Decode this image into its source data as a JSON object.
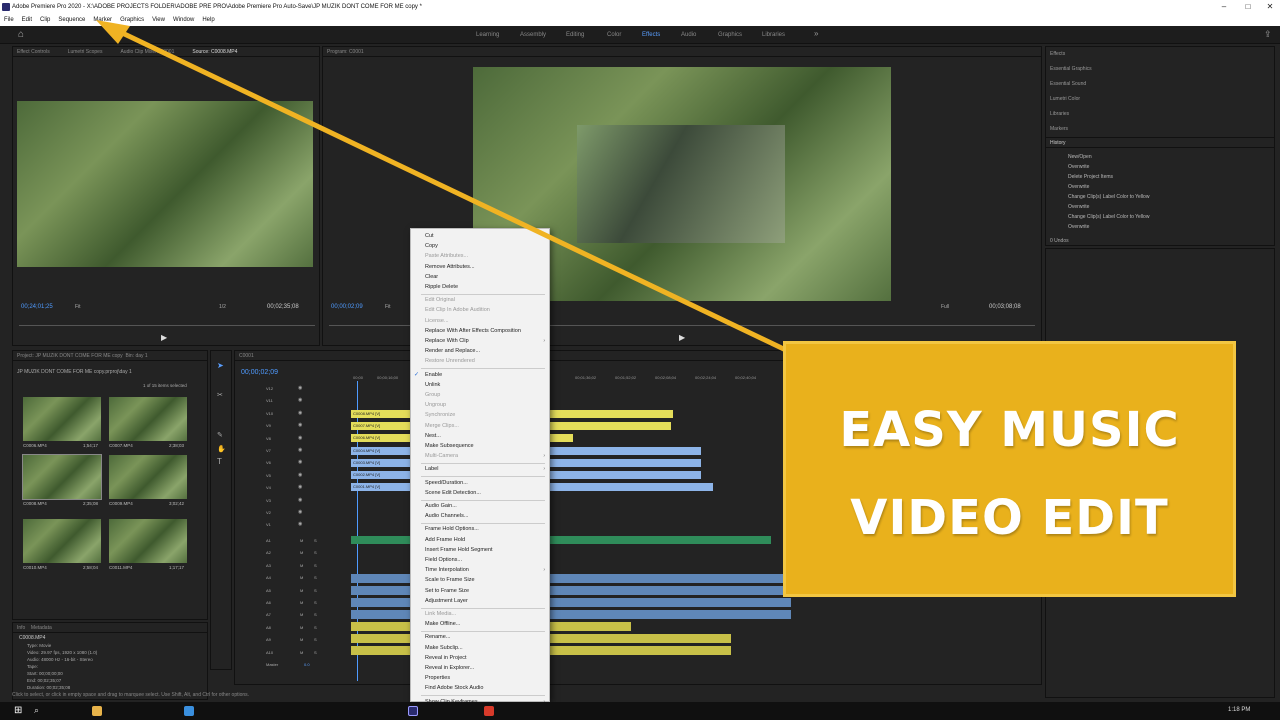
{
  "window": {
    "title": "Adobe Premiere Pro 2020 - X:\\ADOBE PROJECTS FOLDER\\ADOBE PRE PRO\\Adobe Premiere Pro Auto-Save\\JP MUZIK DONT COME FOR ME copy *"
  },
  "menu": [
    "File",
    "Edit",
    "Clip",
    "Sequence",
    "Marker",
    "Graphics",
    "View",
    "Window",
    "Help"
  ],
  "workspaces": [
    "Learning",
    "Assembly",
    "Editing",
    "Color",
    "Effects",
    "Audio",
    "Graphics",
    "Libraries"
  ],
  "active_workspace": "Effects",
  "source_panel": {
    "tabs": [
      "Effect Controls",
      "Lumetri Scopes",
      "Audio Clip Mixer: C0001",
      "Source: C0008.MP4"
    ],
    "timecode": "00;24;01;25",
    "fit": "Fit",
    "fraction": "1/2",
    "duration": "00;02;35;08"
  },
  "program_panel": {
    "title": "Program: C0001",
    "timecode": "00;00;02;09",
    "fit": "Fit",
    "full": "Full",
    "duration": "00;03;08;08"
  },
  "right_panels": [
    "Effects",
    "Essential Graphics",
    "Essential Sound",
    "Lumetri Color",
    "Libraries",
    "Markers"
  ],
  "history": {
    "title": "History",
    "items": [
      "New/Open",
      "Overwrite",
      "Delete Project Items",
      "Overwrite",
      "Change Clip(s) Label Color to Yellow",
      "Overwrite",
      "Change Clip(s) Label Color to Yellow",
      "Overwrite"
    ],
    "undos": "0 Undos"
  },
  "project_panel": {
    "tab": "Project: JP MUZIK DONT COME FOR ME copy",
    "bin": "Bin: day 1",
    "path": "JP MUZIK DONT COME FOR ME copy.prproj\\day 1",
    "count": "1 of 15 items selected",
    "items": [
      {
        "name": "C0006.MP4",
        "dur": "1;54;17"
      },
      {
        "name": "C0007.MP4",
        "dur": "2;38;03"
      },
      {
        "name": "C0008.MP4",
        "dur": "2;35;08"
      },
      {
        "name": "C0009.MP4",
        "dur": "3;02;42"
      },
      {
        "name": "C0010.MP4",
        "dur": "2;58;04"
      },
      {
        "name": "C0011.MP4",
        "dur": "1;17;17"
      }
    ]
  },
  "info_panel": {
    "tabs": [
      "Info",
      "Metadata"
    ],
    "file": "C0008.MP4",
    "lines": [
      "Type: Movie",
      "Video: 29.97 fps, 1920 x 1080 (1.0)",
      "Audio: 48000 Hz - 16-bit - Stereo",
      "Tape:",
      "Start: 00;00;00;00",
      "End: 00;02;35;07",
      "Duration: 00;02;35;08"
    ]
  },
  "timeline": {
    "tab": "C0001",
    "timecode": "00;00;02;09",
    "ruler": [
      "00;00",
      "00;00;16;00",
      "00;01;36;02",
      "00;01;52;02",
      "00;02;08;04",
      "00;02;24;04",
      "00;02;40;04"
    ],
    "video_tracks": [
      "V12",
      "V11",
      "V10",
      "V9",
      "V8",
      "V7",
      "V6",
      "V5",
      "V4",
      "V3",
      "V2",
      "V1"
    ],
    "audio_tracks": [
      "A1",
      "A2",
      "A3",
      "A4",
      "A5",
      "A6",
      "A7",
      "A8",
      "A9",
      "A10"
    ],
    "master": "Master",
    "master_val": "0.0",
    "clips": [
      "C0008.MP4 [V]",
      "C0007.MP4 [V]",
      "C0006.MP4 [V]",
      "C0004.MP4 [V]",
      "C0003.MP4 [V]",
      "C0002.MP4 [V]",
      "C0001.MP4 [V]"
    ]
  },
  "context_menu": {
    "items": [
      {
        "label": "Cut",
        "enabled": true
      },
      {
        "label": "Copy",
        "enabled": true
      },
      {
        "label": "Paste Attributes...",
        "enabled": false
      },
      {
        "label": "Remove Attributes...",
        "enabled": true
      },
      {
        "label": "Clear",
        "enabled": true
      },
      {
        "label": "Ripple Delete",
        "enabled": true
      },
      {
        "label": "Edit Original",
        "enabled": false
      },
      {
        "label": "Edit Clip In Adobe Audition",
        "enabled": false
      },
      {
        "label": "License...",
        "enabled": false
      },
      {
        "label": "Replace With After Effects Composition",
        "enabled": true
      },
      {
        "label": "Replace With Clip",
        "enabled": true,
        "sub": true
      },
      {
        "label": "Render and Replace...",
        "enabled": true
      },
      {
        "label": "Restore Unrendered",
        "enabled": false
      },
      {
        "label": "Enable",
        "enabled": true,
        "checked": true
      },
      {
        "label": "Unlink",
        "enabled": true
      },
      {
        "label": "Group",
        "enabled": false
      },
      {
        "label": "Ungroup",
        "enabled": false
      },
      {
        "label": "Synchronize",
        "enabled": false
      },
      {
        "label": "Merge Clips...",
        "enabled": false
      },
      {
        "label": "Nest...",
        "enabled": true
      },
      {
        "label": "Make Subsequence",
        "enabled": true
      },
      {
        "label": "Multi-Camera",
        "enabled": false,
        "sub": true
      },
      {
        "label": "Label",
        "enabled": true,
        "sub": true
      },
      {
        "label": "Speed/Duration...",
        "enabled": true
      },
      {
        "label": "Scene Edit Detection...",
        "enabled": true
      },
      {
        "label": "Audio Gain...",
        "enabled": true
      },
      {
        "label": "Audio Channels...",
        "enabled": true
      },
      {
        "label": "Frame Hold Options...",
        "enabled": true
      },
      {
        "label": "Add Frame Hold",
        "enabled": true
      },
      {
        "label": "Insert Frame Hold Segment",
        "enabled": true
      },
      {
        "label": "Field Options...",
        "enabled": true
      },
      {
        "label": "Time Interpolation",
        "enabled": true,
        "sub": true
      },
      {
        "label": "Scale to Frame Size",
        "enabled": true
      },
      {
        "label": "Set to Frame Size",
        "enabled": true
      },
      {
        "label": "Adjustment Layer",
        "enabled": true
      },
      {
        "label": "Link Media...",
        "enabled": false
      },
      {
        "label": "Make Offline...",
        "enabled": true
      },
      {
        "label": "Rename...",
        "enabled": true
      },
      {
        "label": "Make Subclip...",
        "enabled": true
      },
      {
        "label": "Reveal in Project",
        "enabled": true
      },
      {
        "label": "Reveal in Explorer...",
        "enabled": true
      },
      {
        "label": "Properties",
        "enabled": true
      },
      {
        "label": "Find Adobe Stock Audio",
        "enabled": true
      },
      {
        "label": "Show Clip Keyframes",
        "enabled": true,
        "sub": true
      }
    ]
  },
  "banner": {
    "line1": "EASY MUSIC",
    "line2": "VIDEO EDIT"
  },
  "status": "Click to select, or click in empty space and drag to marquee select. Use Shift, Alt, and Ctrl for other options.",
  "taskbar": {
    "time": "1:18 PM"
  },
  "colors": {
    "accent": "#5a9fff",
    "banner": "#e9b11c",
    "arrow": "#f0b323",
    "clip_yellow": "#e4dd5a",
    "clip_blue": "#8db4e8"
  }
}
